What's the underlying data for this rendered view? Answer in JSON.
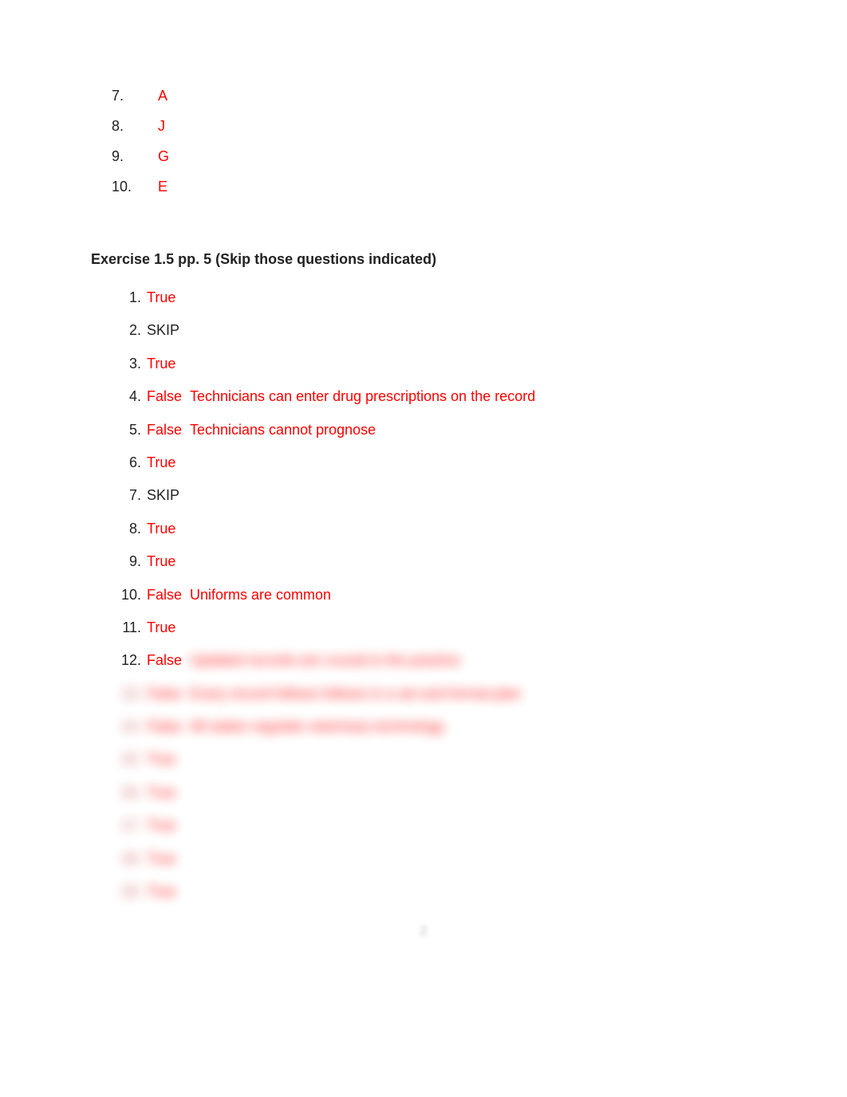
{
  "letter_answers": [
    {
      "num": "7.",
      "ans": "A"
    },
    {
      "num": "8.",
      "ans": "J"
    },
    {
      "num": "9.",
      "ans": "G"
    },
    {
      "num": "10.",
      "ans": "E"
    }
  ],
  "section_title": "Exercise 1.5  pp. 5 (Skip those questions indicated)",
  "tf_items": [
    {
      "num": "1",
      "ans": "True",
      "ans_color": "red",
      "expl": ""
    },
    {
      "num": "2",
      "ans": "SKIP",
      "ans_color": "black",
      "expl": ""
    },
    {
      "num": "3",
      "ans": "True",
      "ans_color": "red",
      "expl": ""
    },
    {
      "num": "4",
      "ans": "False",
      "ans_color": "red",
      "expl": "Technicians can enter drug prescriptions on the record"
    },
    {
      "num": "5",
      "ans": "False",
      "ans_color": "red",
      "expl": "Technicians cannot prognose"
    },
    {
      "num": "6",
      "ans": "True",
      "ans_color": "red",
      "expl": ""
    },
    {
      "num": "7",
      "ans": "SKIP",
      "ans_color": "black",
      "expl": ""
    },
    {
      "num": "8",
      "ans": "True",
      "ans_color": "red",
      "expl": ""
    },
    {
      "num": "9",
      "ans": "True",
      "ans_color": "red",
      "expl": ""
    },
    {
      "num": "10",
      "ans": "False",
      "ans_color": "red",
      "expl": "Uniforms are common"
    },
    {
      "num": "11",
      "ans": "True",
      "ans_color": "red",
      "expl": ""
    },
    {
      "num": "12",
      "ans": "False",
      "ans_color": "red",
      "expl": "Updated records are crucial to the practice"
    }
  ],
  "blurred_items": [
    {
      "num": "13",
      "ans": "False",
      "expl": "Every record follows follows in a set and format plan"
    },
    {
      "num": "14",
      "ans": "False",
      "expl": "All states regulate veterinary technology"
    },
    {
      "num": "15",
      "ans": "True",
      "expl": ""
    },
    {
      "num": "16",
      "ans": "True",
      "expl": ""
    },
    {
      "num": "17",
      "ans": "True",
      "expl": ""
    },
    {
      "num": "18",
      "ans": "True",
      "expl": ""
    },
    {
      "num": "19",
      "ans": "True",
      "expl": ""
    }
  ],
  "page_number": "2"
}
